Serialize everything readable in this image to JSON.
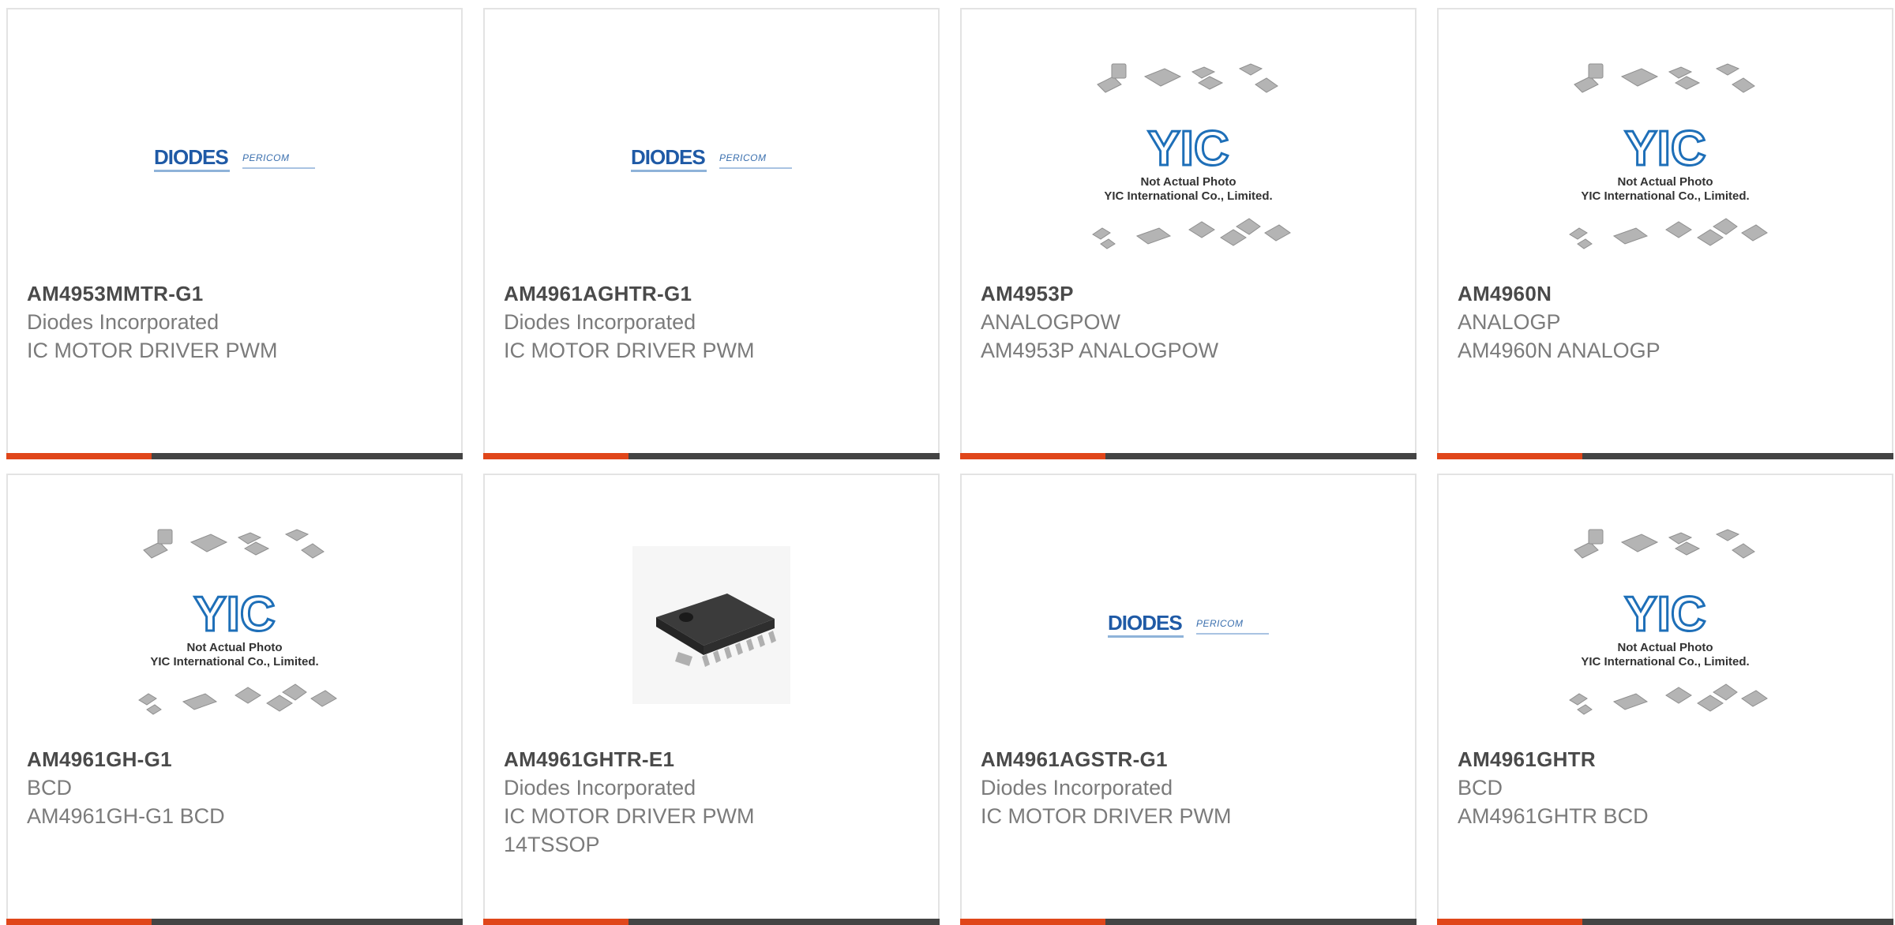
{
  "colors": {
    "accent": "#e0461a",
    "bar": "#444444",
    "border": "#e3e3e3"
  },
  "logo": {
    "diodes": "DIODES",
    "pericom": "PERICOM"
  },
  "placeholder": {
    "brand": "YIC",
    "line1": "Not Actual Photo",
    "line2": "YIC International Co., Limited."
  },
  "products": [
    {
      "part": "AM4953MMTR-G1",
      "maker": "Diodes Incorporated",
      "desc": "IC MOTOR DRIVER PWM",
      "desc2": "",
      "image": "diodes-logo"
    },
    {
      "part": "AM4961AGHTR-G1",
      "maker": "Diodes Incorporated",
      "desc": "IC MOTOR DRIVER PWM",
      "desc2": "",
      "image": "diodes-logo"
    },
    {
      "part": "AM4953P",
      "maker": "ANALOGPOW",
      "desc": "AM4953P ANALOGPOW",
      "desc2": "",
      "image": "yic-placeholder"
    },
    {
      "part": "AM4960N",
      "maker": "ANALOGP",
      "desc": "AM4960N ANALOGP",
      "desc2": "",
      "image": "yic-placeholder"
    },
    {
      "part": "AM4961GH-G1",
      "maker": "BCD",
      "desc": "AM4961GH-G1 BCD",
      "desc2": "",
      "image": "yic-placeholder"
    },
    {
      "part": "AM4961GHTR-E1",
      "maker": "Diodes Incorporated",
      "desc": "IC MOTOR DRIVER PWM",
      "desc2": "14TSSOP",
      "image": "chip-photo"
    },
    {
      "part": "AM4961AGSTR-G1",
      "maker": "Diodes Incorporated",
      "desc": "IC MOTOR DRIVER PWM",
      "desc2": "",
      "image": "diodes-logo"
    },
    {
      "part": "AM4961GHTR",
      "maker": "BCD",
      "desc": "AM4961GHTR BCD",
      "desc2": "",
      "image": "yic-placeholder"
    }
  ]
}
